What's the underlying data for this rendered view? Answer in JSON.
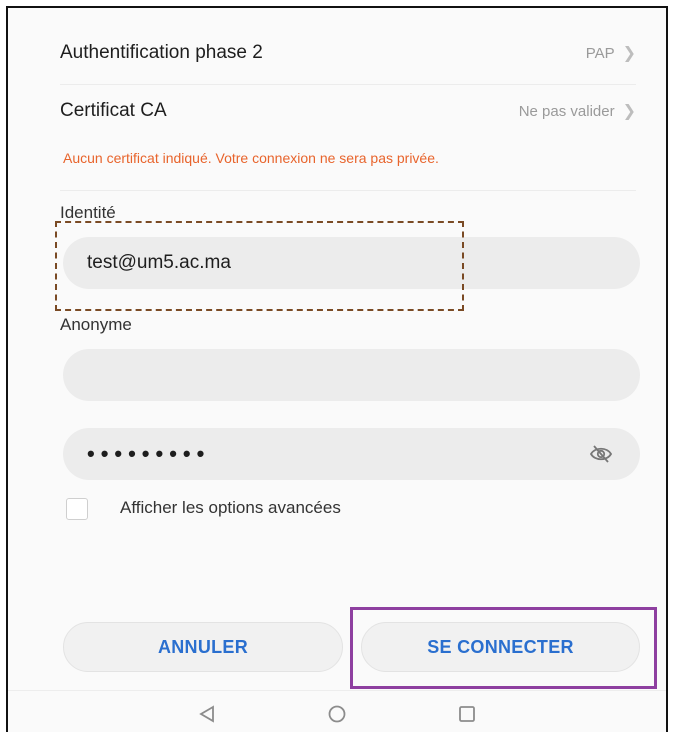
{
  "settings": {
    "phase2": {
      "label": "Authentification phase 2",
      "value": "PAP"
    },
    "ca_cert": {
      "label": "Certificat CA",
      "value": "Ne pas valider"
    },
    "warning": "Aucun certificat indiqué. Votre connexion ne sera pas privée."
  },
  "identity": {
    "label": "Identité",
    "value": "test@um5.ac.ma"
  },
  "anonymous": {
    "label": "Anonyme",
    "value": ""
  },
  "password": {
    "masked": "•••••••••",
    "toggle_icon": "eye-off-icon"
  },
  "advanced": {
    "label": "Afficher les options avancées",
    "checked": false
  },
  "buttons": {
    "cancel": "ANNULER",
    "connect": "SE CONNECTER"
  },
  "navbar": {
    "icons": [
      "back-triangle-icon",
      "home-circle-icon",
      "recents-square-icon"
    ]
  },
  "colors": {
    "warning": "#e8642c",
    "button_text": "#2a6fcf",
    "highlight_dashed": "#7a4a24",
    "highlight_purple": "#8e3fa0"
  }
}
